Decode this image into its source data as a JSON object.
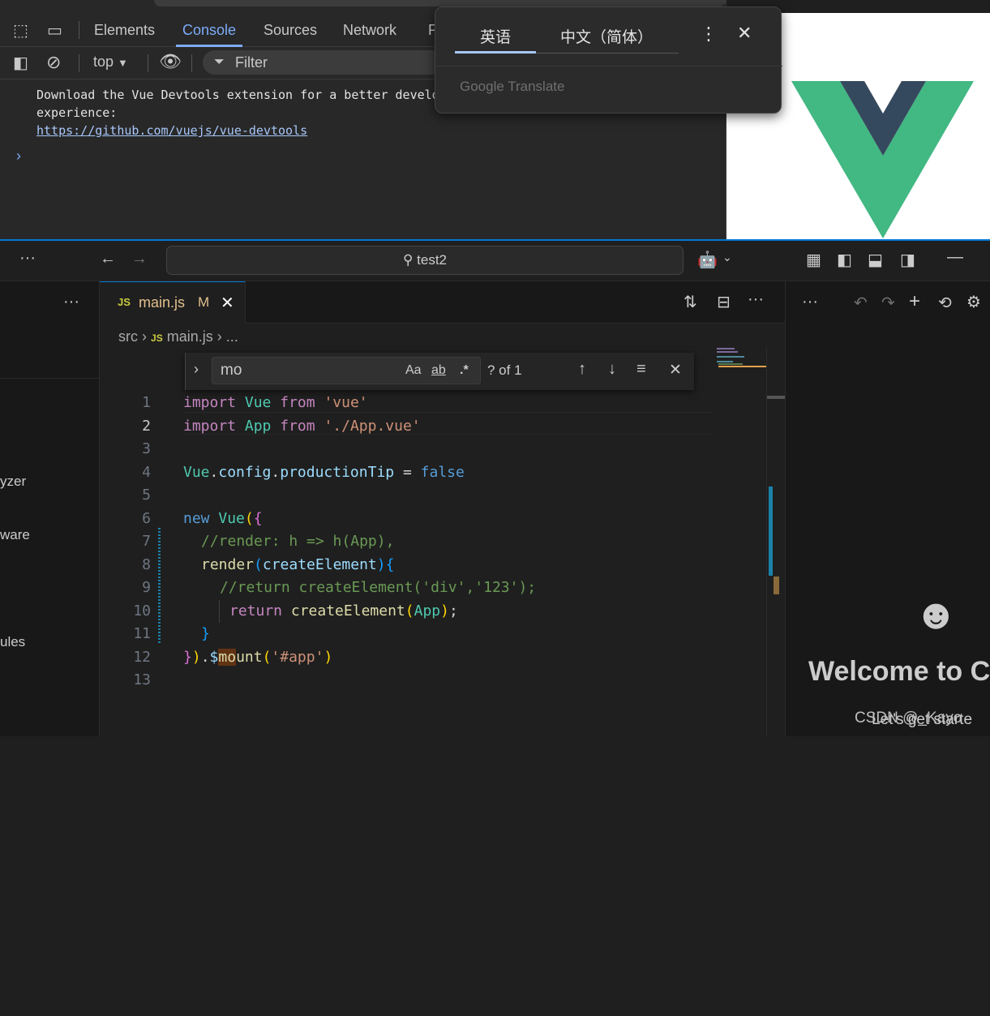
{
  "devtools": {
    "tabs": [
      "Elements",
      "Console",
      "Sources",
      "Network",
      "P"
    ],
    "active_tab": "Console",
    "context": "top",
    "filter_placeholder": "Filter",
    "console_message": {
      "line1": "Download the Vue Devtools extension for a better develo",
      "line2": "experience:",
      "link": "https://github.com/vuejs/vue-devtools"
    },
    "prompt": "›"
  },
  "translate": {
    "tab_source": "英语",
    "tab_target": "中文（简体）",
    "brand": "Google Translate"
  },
  "vscode": {
    "search_text": "test2",
    "sidebar_items": [
      "yzer",
      "ware",
      "ules"
    ],
    "tab": {
      "lang": "JS",
      "filename": "main.js",
      "status": "M"
    },
    "breadcrumb": {
      "root": "src",
      "lang": "JS",
      "file": "main.js",
      "more": "..."
    },
    "find": {
      "query": "mo",
      "match_case": "Aa",
      "whole_word": "ab",
      "regex": ".*",
      "count": "? of 1"
    },
    "line_numbers": [
      "1",
      "2",
      "3",
      "4",
      "5",
      "6",
      "7",
      "8",
      "9",
      "10",
      "11",
      "12",
      "13"
    ],
    "code": {
      "l1": [
        "import",
        "Vue",
        "from",
        "'vue'"
      ],
      "l2": [
        "import",
        "App",
        "from",
        "'./App.vue'"
      ],
      "l4": [
        "Vue",
        ".",
        "config",
        ".",
        "productionTip",
        " = ",
        "false"
      ],
      "l6": [
        "new",
        "Vue",
        "(",
        "{"
      ],
      "l7": "//render: h => h(App),",
      "l8": [
        "render",
        "(",
        "createElement",
        ")",
        "{"
      ],
      "l9": "//return createElement('div','123');",
      "l10": [
        "return",
        "createElement",
        "(",
        "App",
        ")",
        ";"
      ],
      "l11": "}",
      "l12": [
        "}",
        ")",
        ".",
        "$",
        "mo",
        "unt",
        "(",
        "'#app'",
        ")"
      ]
    },
    "chat": {
      "welcome": "Welcome to C",
      "sub": "Let's get starte"
    },
    "watermark": "CSDN @_Kayo"
  }
}
